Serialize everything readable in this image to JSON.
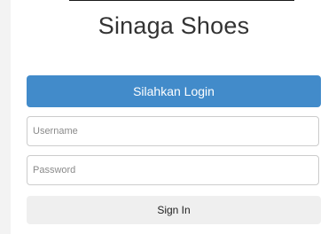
{
  "app": {
    "title": "Sinaga Shoes"
  },
  "login": {
    "banner_label": "Silahkan Login",
    "username_placeholder": "Username",
    "password_placeholder": "Password",
    "signin_label": "Sign In"
  },
  "colors": {
    "banner": "#428bca",
    "signin_button": "#efefef"
  }
}
